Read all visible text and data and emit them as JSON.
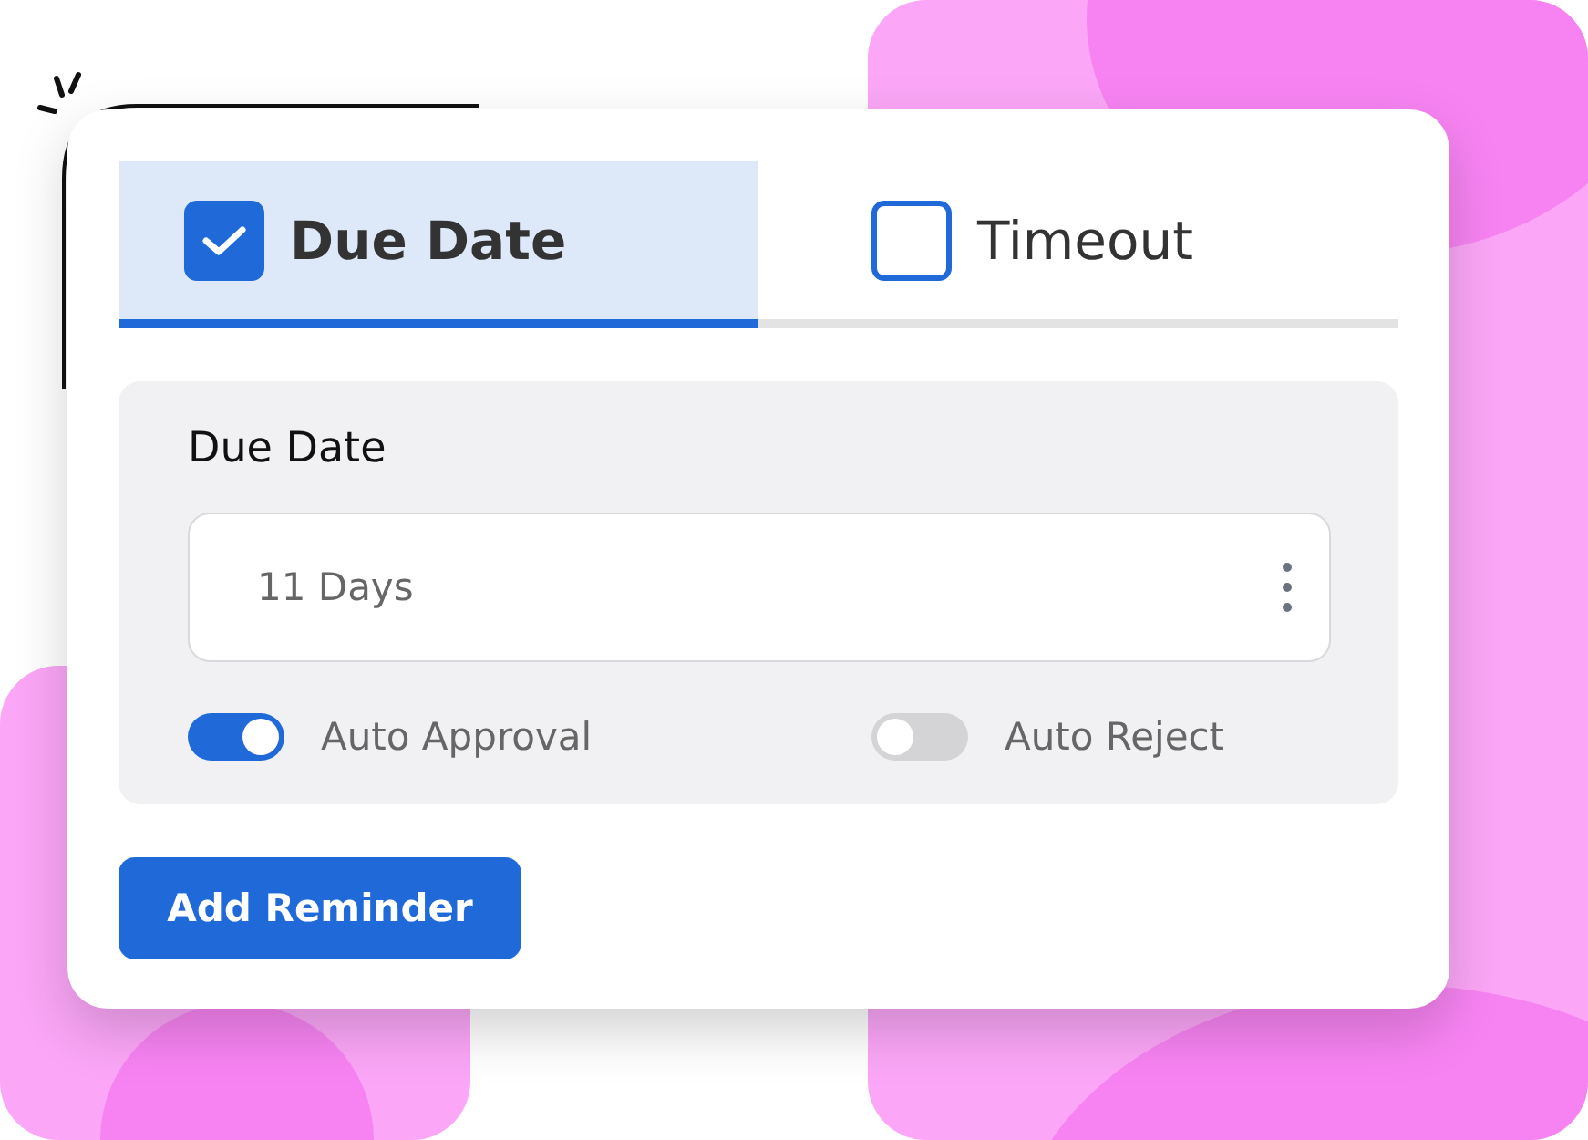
{
  "tabs": [
    {
      "label": "Due Date",
      "checked": true,
      "selected": true
    },
    {
      "label": "Timeout",
      "checked": false,
      "selected": false
    }
  ],
  "panel": {
    "title": "Due Date",
    "field": {
      "value": "11 Days"
    },
    "toggles": [
      {
        "label": "Auto Approval",
        "on": true
      },
      {
        "label": "Auto Reject",
        "on": false
      }
    ]
  },
  "button": "Add Reminder"
}
